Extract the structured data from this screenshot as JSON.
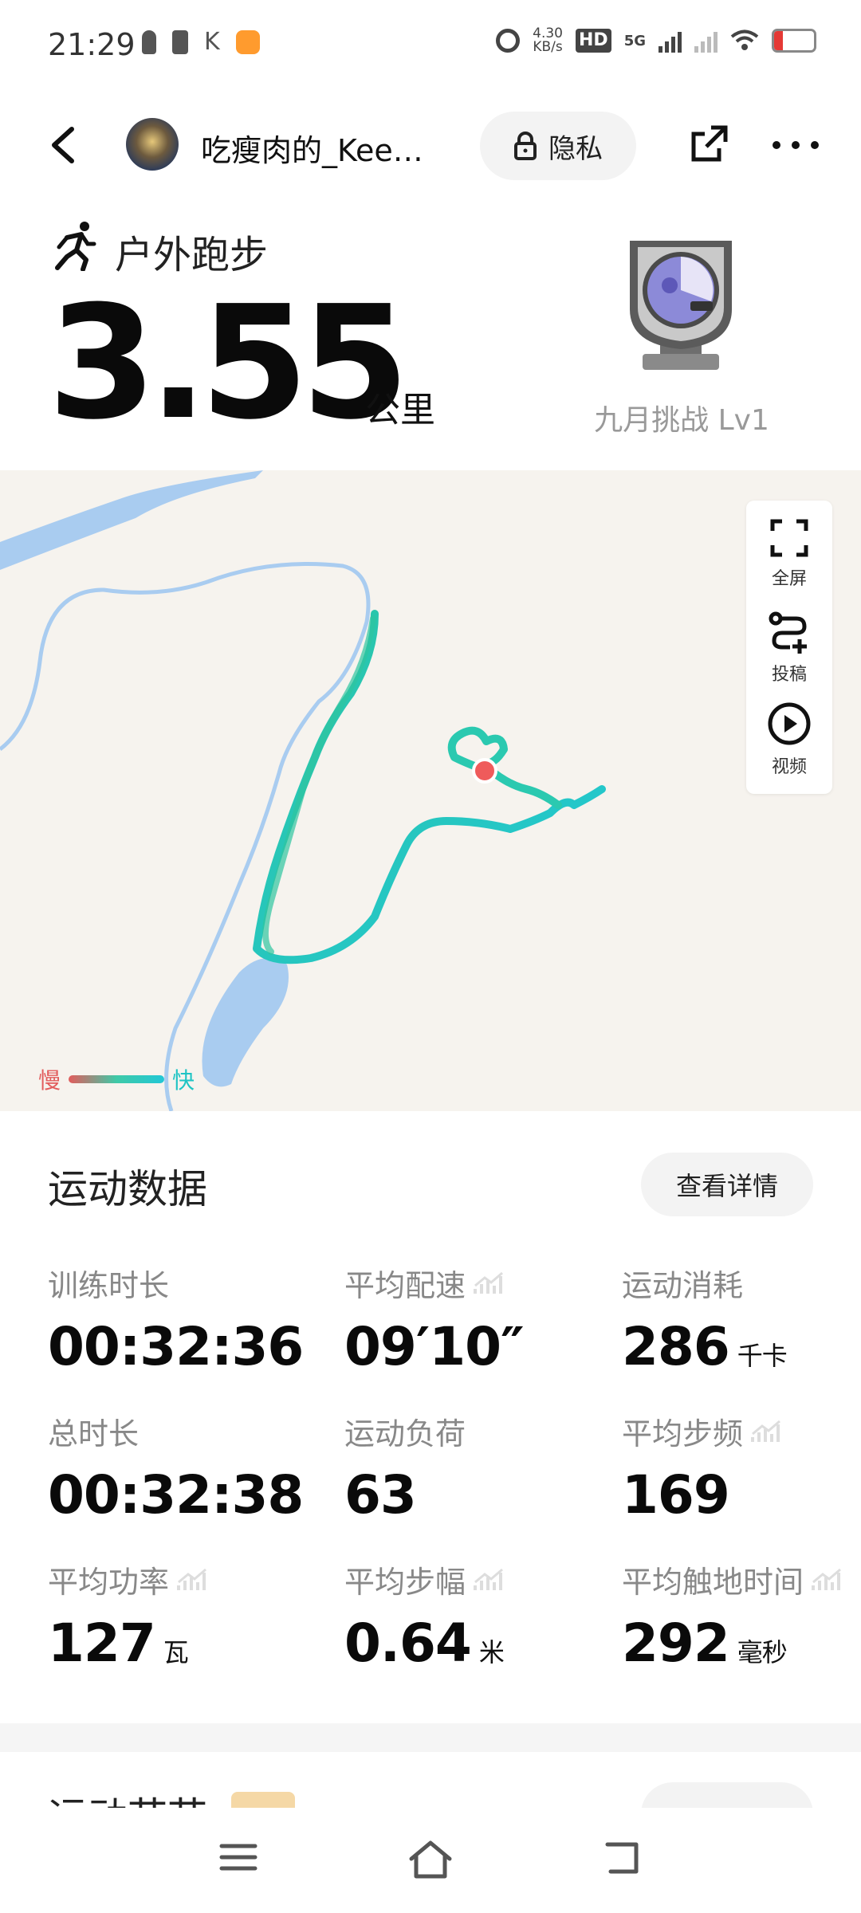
{
  "status_bar": {
    "time": "21:29",
    "net_speed_value": "4.30",
    "net_speed_unit": "KB/s",
    "hd": "HD",
    "network": "5G",
    "battery": "17"
  },
  "header": {
    "username": "吃瘦肉的_Kee…",
    "privacy_label": "隐私"
  },
  "summary": {
    "sport_type": "户外跑步",
    "distance": "3.55",
    "distance_unit": "公里",
    "badge_label": "九月挑战 Lv1"
  },
  "map": {
    "tools": [
      {
        "label": "全屏",
        "icon": "fullscreen-icon"
      },
      {
        "label": "投稿",
        "icon": "route-submit-icon"
      },
      {
        "label": "视频",
        "icon": "play-video-icon"
      }
    ],
    "legend_slow": "慢",
    "legend_fast": "快",
    "colors": {
      "slow": "#e25c5c",
      "fast": "#22c7d6",
      "water": "#a9ccf0",
      "background": "#f6f3ee"
    }
  },
  "stats": {
    "title": "运动数据",
    "details_button": "查看详情",
    "items": [
      {
        "label": "训练时长",
        "value": "00:32:36",
        "unit": ""
      },
      {
        "label": "平均配速",
        "value": "09′10″",
        "unit": ""
      },
      {
        "label": "运动消耗",
        "value": "286",
        "unit": "千卡"
      },
      {
        "label": "总时长",
        "value": "00:32:38",
        "unit": ""
      },
      {
        "label": "运动负荷",
        "value": "63",
        "unit": ""
      },
      {
        "label": "平均步频",
        "value": "169",
        "unit": ""
      },
      {
        "label": "平均功率",
        "value": "127",
        "unit": "瓦"
      },
      {
        "label": "平均步幅",
        "value": "0.64",
        "unit": "米"
      },
      {
        "label": "平均触地时间",
        "value": "292",
        "unit": "毫秒"
      }
    ]
  },
  "next_section": {
    "title": "运动节节"
  }
}
